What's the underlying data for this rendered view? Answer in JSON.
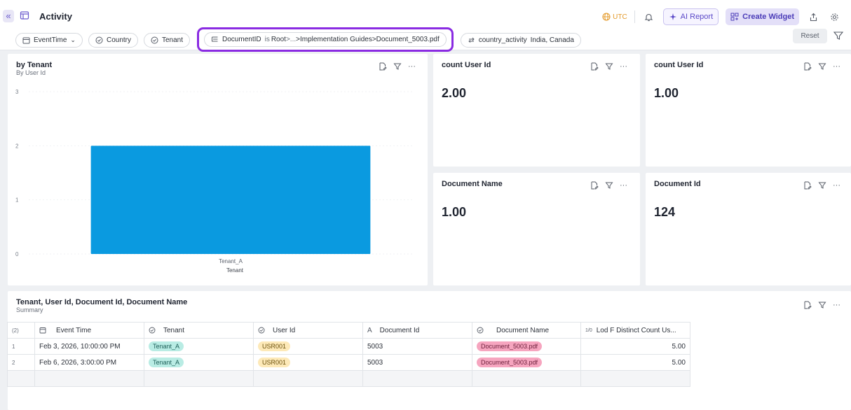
{
  "header": {
    "title": "Activity",
    "utc_label": "UTC",
    "ai_report_label": "AI Report",
    "create_widget_label": "Create Widget"
  },
  "filters": {
    "event_time": "EventTime",
    "country": "Country",
    "tenant": "Tenant",
    "document_path": {
      "field": "DocumentID",
      "op": "is",
      "root": "Root",
      "ellipsis": ">...",
      "guides": ">Implementation Guides",
      "file": ">Document_5003.pdf"
    },
    "country_activity": {
      "field": "country_activity",
      "values": "India, Canada"
    },
    "reset_label": "Reset"
  },
  "bar_card": {
    "title": "by Tenant",
    "subtitle": "By User Id",
    "chart_data": {
      "type": "bar",
      "categories": [
        "Tenant_A"
      ],
      "values": [
        2
      ],
      "title": "by Tenant",
      "subtitle": "By User Id",
      "xlabel": "Tenant",
      "ylabel": "",
      "ylim": [
        0,
        3
      ],
      "yticks": [
        "0",
        "1",
        "2",
        "3"
      ],
      "bar_color": "#0a9ae0"
    }
  },
  "metrics": [
    {
      "title": "count User Id",
      "value": "2.00"
    },
    {
      "title": "count User Id",
      "value": "1.00"
    },
    {
      "title": "Document Name",
      "value": "1.00"
    },
    {
      "title": "Document Id",
      "value": "124"
    }
  ],
  "table": {
    "title": "Tenant, User Id, Document Id, Document Name",
    "subtitle": "Summary",
    "row_count_label": "(2)",
    "columns": [
      "Event Time",
      "Tenant",
      "User Id",
      "Document Id",
      "Document Name",
      "Lod F Distinct Count Us..."
    ],
    "rows": [
      {
        "num": "1",
        "event_time": "Feb 3, 2026, 10:00:00 PM",
        "tenant": "Tenant_A",
        "user_id": "USR001",
        "document_id": "5003",
        "document_name": "Document_5003.pdf",
        "lod": "5.00"
      },
      {
        "num": "2",
        "event_time": "Feb 6, 2026, 3:00:00 PM",
        "tenant": "Tenant_A",
        "user_id": "USR001",
        "document_id": "5003",
        "document_name": "Document_5003.pdf",
        "lod": "5.00"
      }
    ]
  },
  "colors": {
    "accent": "#6a5acd",
    "highlight_outline": "#8a2be2",
    "bar": "#0a9ae0",
    "utc": "#e49a2a"
  }
}
